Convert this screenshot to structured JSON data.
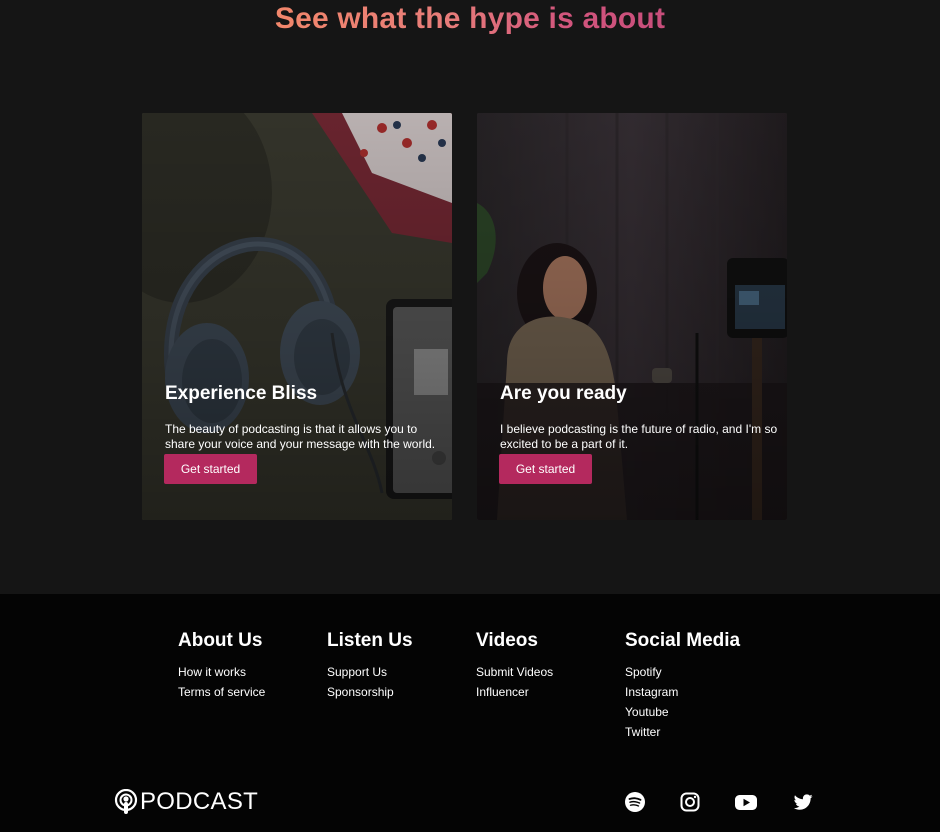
{
  "hero": {
    "title": "See what the hype is about"
  },
  "cards": [
    {
      "title": "Experience Bliss",
      "text": "The beauty of podcasting is that it allows you to\nshare your voice and your message with the world.",
      "button": "Get started"
    },
    {
      "title": "Are you ready",
      "text": "I believe podcasting is the future of radio, and I'm so\nexcited to be a part of it.",
      "button": "Get started"
    }
  ],
  "footer": {
    "columns": [
      {
        "heading": "About Us",
        "links": [
          "How it works",
          "Terms of service"
        ]
      },
      {
        "heading": "Listen Us",
        "links": [
          "Support Us",
          "Sponsorship"
        ]
      },
      {
        "heading": "Videos",
        "links": [
          "Submit Videos",
          "Influencer"
        ]
      },
      {
        "heading": "Social Media",
        "links": [
          "Spotify",
          "Instagram",
          "Youtube",
          "Twitter"
        ]
      }
    ],
    "logo": {
      "text": "PODCAST",
      "icon": "podcast-icon"
    },
    "social_icons": [
      "spotify-icon",
      "instagram-icon",
      "youtube-icon",
      "twitter-icon"
    ]
  },
  "colors": {
    "background": "#151515",
    "footer_background": "#040404",
    "accent": "#b4295e",
    "title_gradient_start": "#f2876b",
    "title_gradient_end": "#c84e7b"
  }
}
